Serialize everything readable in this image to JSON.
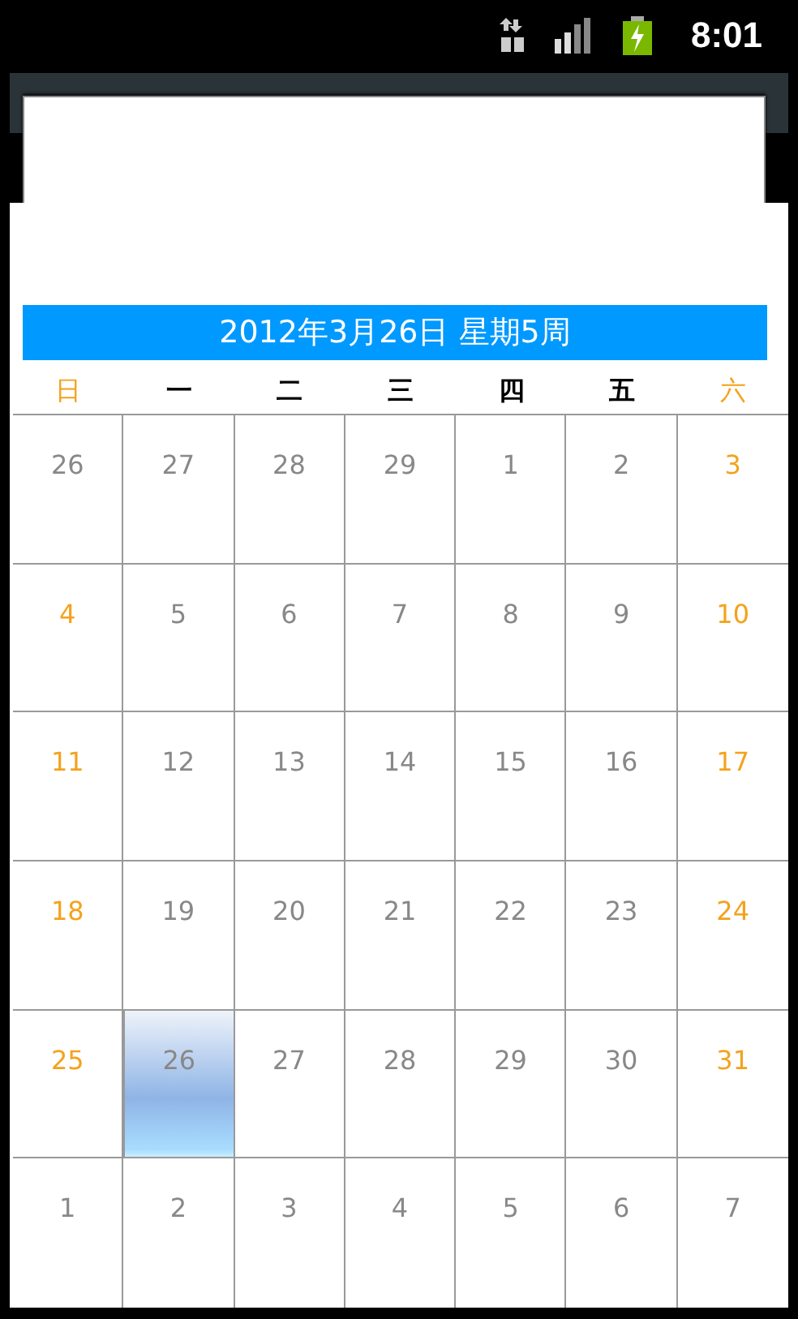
{
  "status_bar": {
    "time": "8:01"
  },
  "header": {
    "title": "2012年3月26日 星期5周"
  },
  "weekdays": [
    {
      "label": "日",
      "weekend": true
    },
    {
      "label": "一",
      "weekend": false
    },
    {
      "label": "二",
      "weekend": false
    },
    {
      "label": "三",
      "weekend": false
    },
    {
      "label": "四",
      "weekend": false
    },
    {
      "label": "五",
      "weekend": false
    },
    {
      "label": "六",
      "weekend": true
    }
  ],
  "days": [
    {
      "label": "26",
      "weekend": false,
      "selected": false
    },
    {
      "label": "27",
      "weekend": false,
      "selected": false
    },
    {
      "label": "28",
      "weekend": false,
      "selected": false
    },
    {
      "label": "29",
      "weekend": false,
      "selected": false
    },
    {
      "label": "1",
      "weekend": false,
      "selected": false
    },
    {
      "label": "2",
      "weekend": false,
      "selected": false
    },
    {
      "label": "3",
      "weekend": true,
      "selected": false
    },
    {
      "label": "4",
      "weekend": true,
      "selected": false
    },
    {
      "label": "5",
      "weekend": false,
      "selected": false
    },
    {
      "label": "6",
      "weekend": false,
      "selected": false
    },
    {
      "label": "7",
      "weekend": false,
      "selected": false
    },
    {
      "label": "8",
      "weekend": false,
      "selected": false
    },
    {
      "label": "9",
      "weekend": false,
      "selected": false
    },
    {
      "label": "10",
      "weekend": true,
      "selected": false
    },
    {
      "label": "11",
      "weekend": true,
      "selected": false
    },
    {
      "label": "12",
      "weekend": false,
      "selected": false
    },
    {
      "label": "13",
      "weekend": false,
      "selected": false
    },
    {
      "label": "14",
      "weekend": false,
      "selected": false
    },
    {
      "label": "15",
      "weekend": false,
      "selected": false
    },
    {
      "label": "16",
      "weekend": false,
      "selected": false
    },
    {
      "label": "17",
      "weekend": true,
      "selected": false
    },
    {
      "label": "18",
      "weekend": true,
      "selected": false
    },
    {
      "label": "19",
      "weekend": false,
      "selected": false
    },
    {
      "label": "20",
      "weekend": false,
      "selected": false
    },
    {
      "label": "21",
      "weekend": false,
      "selected": false
    },
    {
      "label": "22",
      "weekend": false,
      "selected": false
    },
    {
      "label": "23",
      "weekend": false,
      "selected": false
    },
    {
      "label": "24",
      "weekend": true,
      "selected": false
    },
    {
      "label": "25",
      "weekend": true,
      "selected": false
    },
    {
      "label": "26",
      "weekend": false,
      "selected": true
    },
    {
      "label": "27",
      "weekend": false,
      "selected": false
    },
    {
      "label": "28",
      "weekend": false,
      "selected": false
    },
    {
      "label": "29",
      "weekend": false,
      "selected": false
    },
    {
      "label": "30",
      "weekend": false,
      "selected": false
    },
    {
      "label": "31",
      "weekend": true,
      "selected": false
    },
    {
      "label": "1",
      "weekend": false,
      "selected": false
    },
    {
      "label": "2",
      "weekend": false,
      "selected": false
    },
    {
      "label": "3",
      "weekend": false,
      "selected": false
    },
    {
      "label": "4",
      "weekend": false,
      "selected": false
    },
    {
      "label": "5",
      "weekend": false,
      "selected": false
    },
    {
      "label": "6",
      "weekend": false,
      "selected": false
    },
    {
      "label": "7",
      "weekend": false,
      "selected": false
    }
  ]
}
